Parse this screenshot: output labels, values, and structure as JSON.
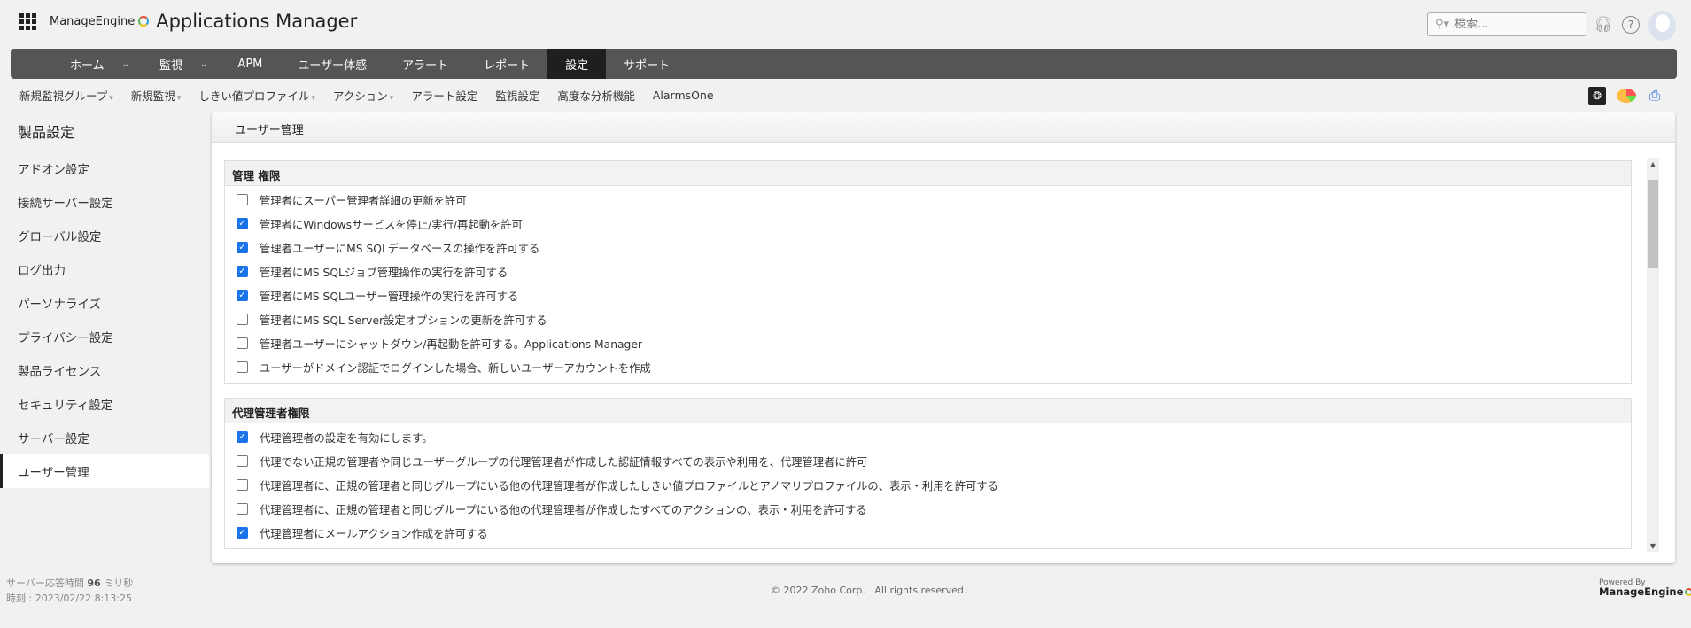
{
  "header": {
    "brand": "ManageEngine",
    "app_title": "Applications Manager",
    "search_placeholder": "検索...",
    "icons": [
      "apps-grid-icon",
      "support-headset-icon",
      "help-icon",
      "avatar"
    ]
  },
  "nav": {
    "items": [
      {
        "label": "ホーム",
        "caret": true
      },
      {
        "label": "監視",
        "caret": true
      },
      {
        "label": "APM"
      },
      {
        "label": "ユーザー体感"
      },
      {
        "label": "アラート"
      },
      {
        "label": "レポート"
      },
      {
        "label": "設定",
        "active": true
      },
      {
        "label": "サポート"
      }
    ]
  },
  "subnav": {
    "items": [
      {
        "label": "新規監視グループ",
        "caret": true
      },
      {
        "label": "新規監視",
        "caret": true
      },
      {
        "label": "しきい値プロファイル",
        "caret": true
      },
      {
        "label": "アクション",
        "caret": true
      },
      {
        "label": "アラート設定"
      },
      {
        "label": "監視設定"
      },
      {
        "label": "高度な分析機能"
      },
      {
        "label": "AlarmsOne"
      }
    ],
    "caret": "▾"
  },
  "sidebar": {
    "title": "製品設定",
    "items": [
      "アドオン設定",
      "接続サーバー設定",
      "グローバル設定",
      "ログ出力",
      "パーソナライズ",
      "プライバシー設定",
      "製品ライセンス",
      "セキュリティ設定",
      "サーバー設定",
      "ユーザー管理"
    ],
    "active_index": 9
  },
  "panel": {
    "title": "ユーザー管理",
    "sections": [
      {
        "title": "管理 権限",
        "rows": [
          {
            "label": "管理者にスーパー管理者詳細の更新を許可",
            "checked": false
          },
          {
            "label": "管理者にWindowsサービスを停止/実行/再起動を許可",
            "checked": true
          },
          {
            "label": "管理者ユーザーにMS SQLデータベースの操作を許可する",
            "checked": true
          },
          {
            "label": "管理者にMS SQLジョブ管理操作の実行を許可する",
            "checked": true
          },
          {
            "label": "管理者にMS SQLユーザー管理操作の実行を許可する",
            "checked": true
          },
          {
            "label": "管理者にMS SQL Server設定オプションの更新を許可する",
            "checked": false
          },
          {
            "label": "管理者ユーザーにシャットダウン/再起動を許可する。Applications Manager",
            "checked": false
          },
          {
            "label": "ユーザーがドメイン認証でログインした場合、新しいユーザーアカウントを作成",
            "checked": false
          }
        ]
      },
      {
        "title": "代理管理者権限",
        "rows": [
          {
            "label": "代理管理者の設定を有効にします。",
            "checked": true
          },
          {
            "label": "代理でない正規の管理者や同じユーザーグループの代理管理者が作成した認証情報すべての表示や利用を、代理管理者に許可",
            "checked": false
          },
          {
            "label": "代理管理者に、正規の管理者と同じグループにいる他の代理管理者が作成したしきい値プロファイルとアノマリプロファイルの、表示・利用を許可する",
            "checked": false
          },
          {
            "label": "代理管理者に、正規の管理者と同じグループにいる他の代理管理者が作成したすべてのアクションの、表示・利用を許可する",
            "checked": false
          },
          {
            "label": "代理管理者にメールアクション作成を許可する",
            "checked": true
          }
        ]
      }
    ]
  },
  "footer": {
    "response_label": "サーバー応答時間",
    "response_value": "96",
    "response_unit": "ミリ秒",
    "time_label": "時刻 : 2023/02/22 8:13:25",
    "copyright": "© 2022 Zoho Corp.   All rights reserved.",
    "powered_by": "Powered By",
    "powered_brand": "ManageEngine"
  },
  "colors": {
    "nav_bg": "#555555",
    "nav_active": "#1f1f1f",
    "checkbox": "#1a73e8"
  }
}
